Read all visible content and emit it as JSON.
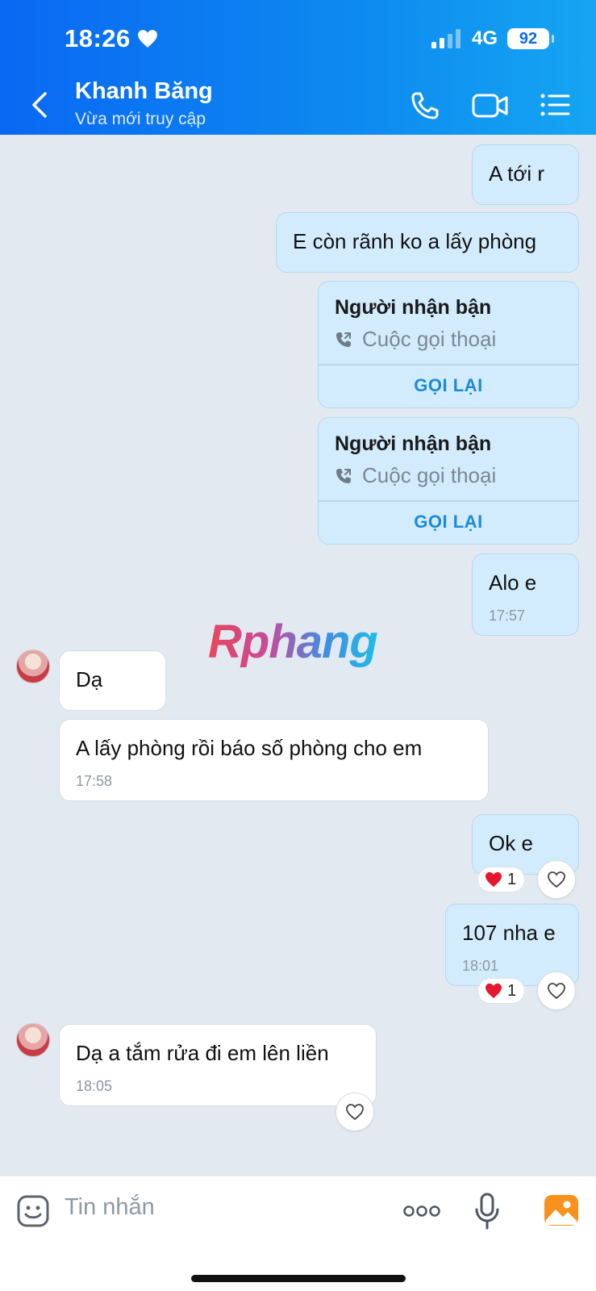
{
  "status_bar": {
    "time": "18:26",
    "network": "4G",
    "battery": "92"
  },
  "header": {
    "title": "Khanh Băng",
    "subtitle": "Vừa mới truy cập"
  },
  "messages": [
    {
      "text": "A tới r"
    },
    {
      "text": "E còn rãnh ko a lấy phòng"
    },
    {
      "call_title": "Người nhận bận",
      "call_sub": "Cuộc gọi thoại",
      "action": "GỌI LẠI"
    },
    {
      "call_title": "Người nhận bận",
      "call_sub": "Cuộc gọi thoại",
      "action": "GỌI LẠI"
    },
    {
      "text": "Alo e",
      "time": "17:57"
    },
    {
      "text": "Dạ"
    },
    {
      "text": "A lấy phòng rồi báo số phòng cho em",
      "time": "17:58"
    },
    {
      "text": "Ok e",
      "reaction_count": "1"
    },
    {
      "text": "107 nha e",
      "time": "18:01",
      "reaction_count": "1"
    },
    {
      "text": "Dạ a tắm rửa đi em lên liền",
      "time": "18:05"
    }
  ],
  "watermark": "Rphang",
  "composer": {
    "placeholder": "Tin nhắn"
  },
  "colors": {
    "header_start": "#0a68f2",
    "header_end": "#15a5f2",
    "outgoing_bubble": "#d3ecfd",
    "chat_bg": "#e2e9f1",
    "action_blue": "#1a8ad8"
  },
  "icons": [
    "heart-icon",
    "signal-icon",
    "back-icon",
    "phone-icon",
    "video-icon",
    "menu-icon",
    "call-icon",
    "sticker-icon",
    "more-icon",
    "mic-icon",
    "image-icon"
  ]
}
